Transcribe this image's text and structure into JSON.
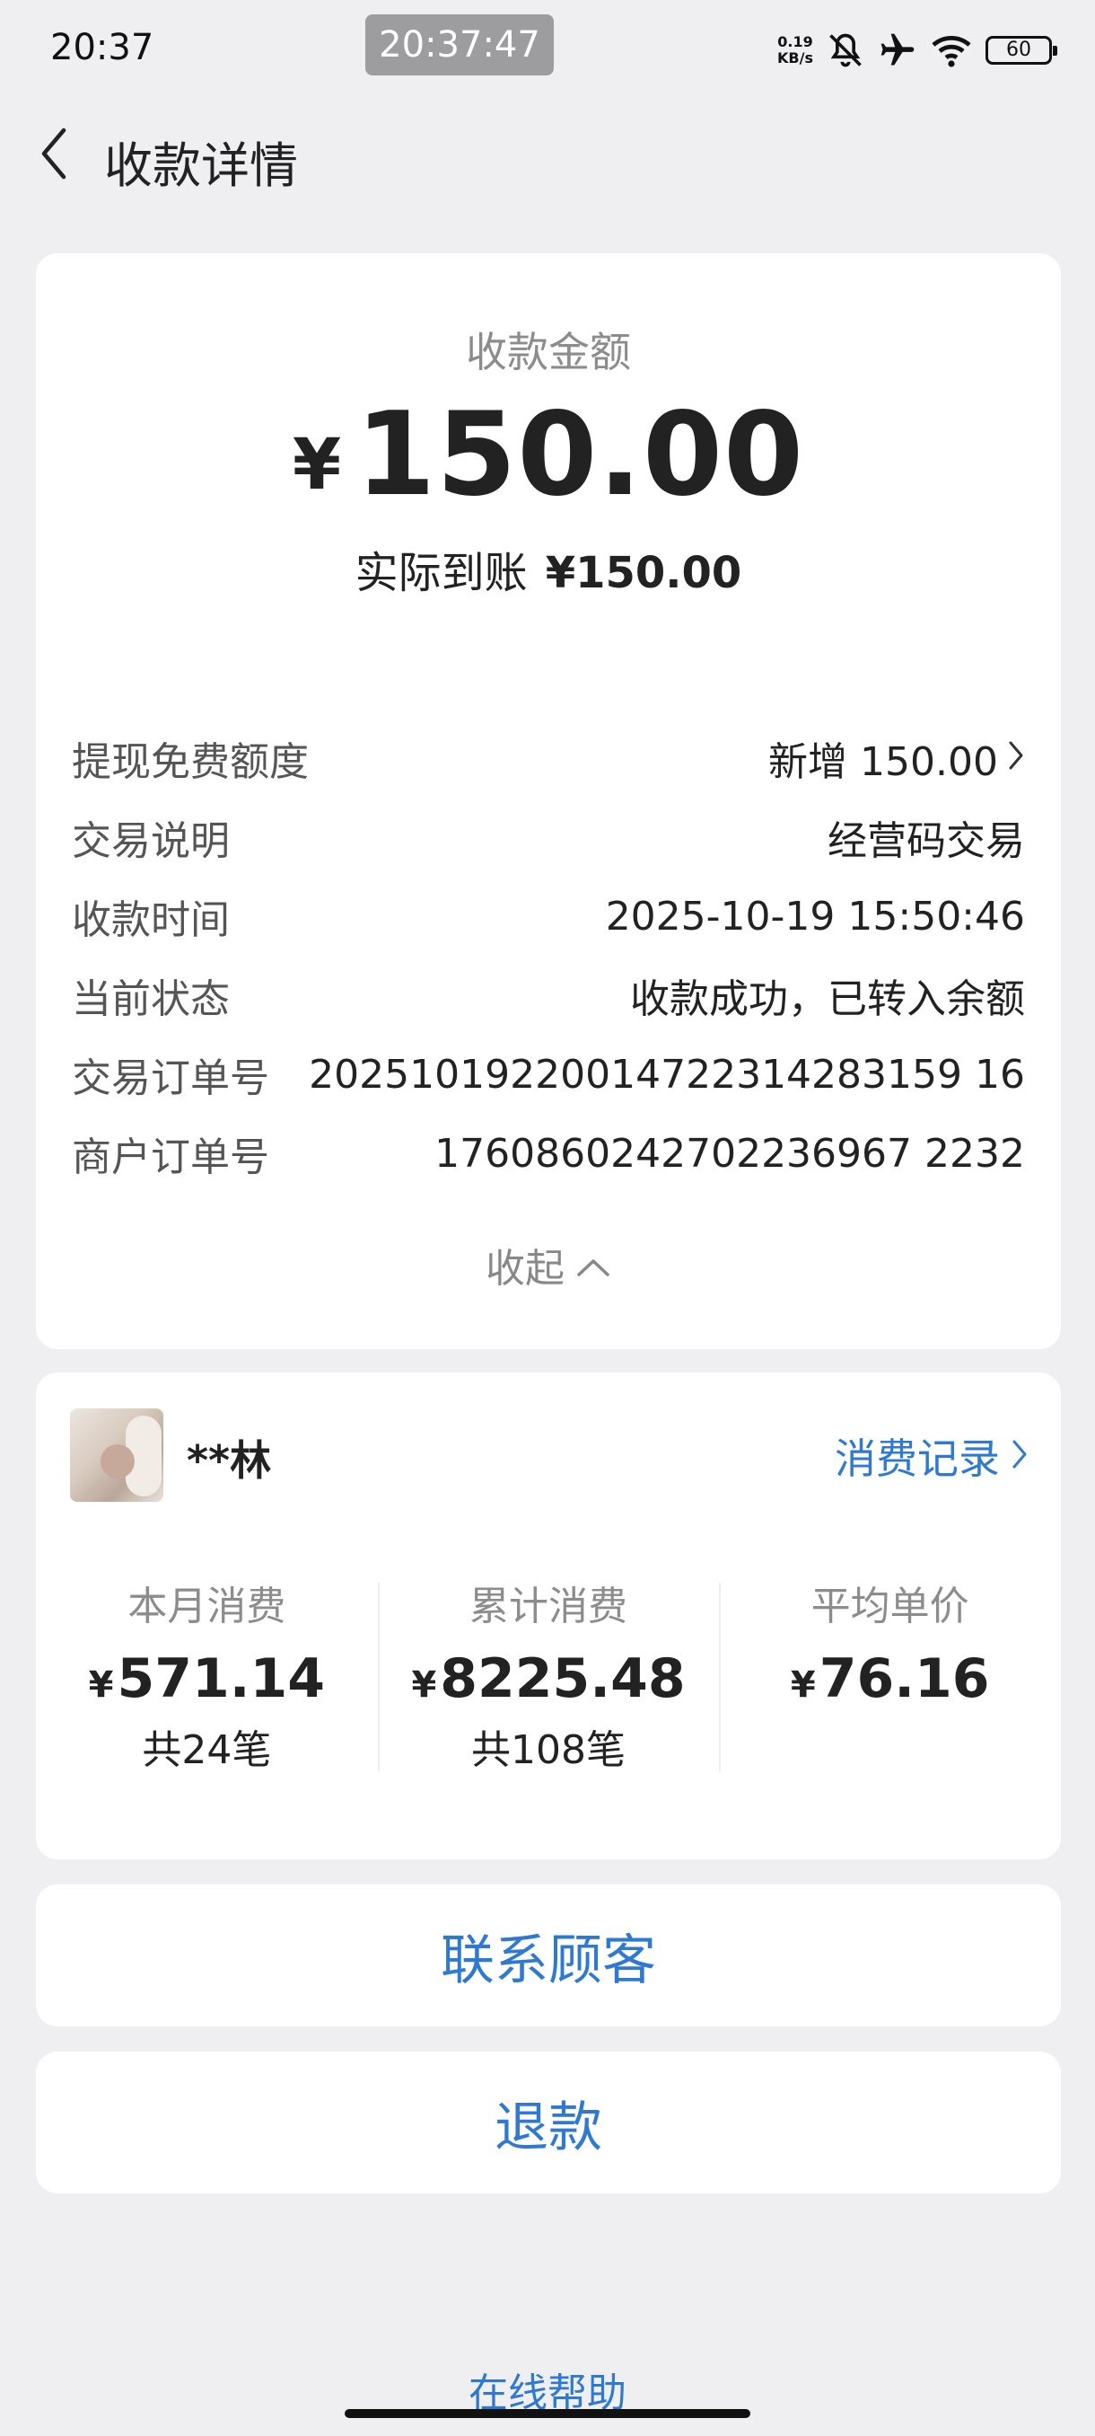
{
  "status_bar": {
    "time": "20:37",
    "clock_pill": "20:37:47",
    "net_speed_value": "0.19",
    "net_speed_unit": "KB/s",
    "battery": "60",
    "icons": [
      "mute-icon",
      "airplane-icon",
      "wifi-icon",
      "battery-icon"
    ]
  },
  "header": {
    "title": "收款详情",
    "back_icon": "chevron-left-icon"
  },
  "summary": {
    "amount_label": "收款金额",
    "currency": "¥",
    "amount": "150.00",
    "arrival_label": "实际到账",
    "arrival_value": "¥150.00"
  },
  "details": [
    {
      "key": "提现免费额度",
      "value": "新增 150.00"
    },
    {
      "key": "交易说明",
      "value": "经营码交易"
    },
    {
      "key": "收款时间",
      "value": "2025-10-19 15:50:46"
    },
    {
      "key": "当前状态",
      "value": "收款成功，已转入余额"
    },
    {
      "key": "交易订单号",
      "value": "20251019220014722314283159 16"
    },
    {
      "key": "商户订单号",
      "value": "1760860242702236967 2232"
    }
  ],
  "collapse_label": "收起",
  "customer": {
    "name": "**林",
    "records_link": "消费记录",
    "stats": [
      {
        "label": "本月消费",
        "currency": "¥",
        "amount": "571.14",
        "count": "共24笔"
      },
      {
        "label": "累计消费",
        "currency": "¥",
        "amount": "8225.48",
        "count": "共108笔"
      },
      {
        "label": "平均单价",
        "currency": "¥",
        "amount": "76.16",
        "count": ""
      }
    ]
  },
  "actions": {
    "contact": "联系顾客",
    "refund": "退款"
  },
  "help_link": "在线帮助",
  "colors": {
    "background": "#efeff1",
    "card": "#ffffff",
    "link_blue": "#2f79d0",
    "muted_text": "#8c8c8c"
  }
}
